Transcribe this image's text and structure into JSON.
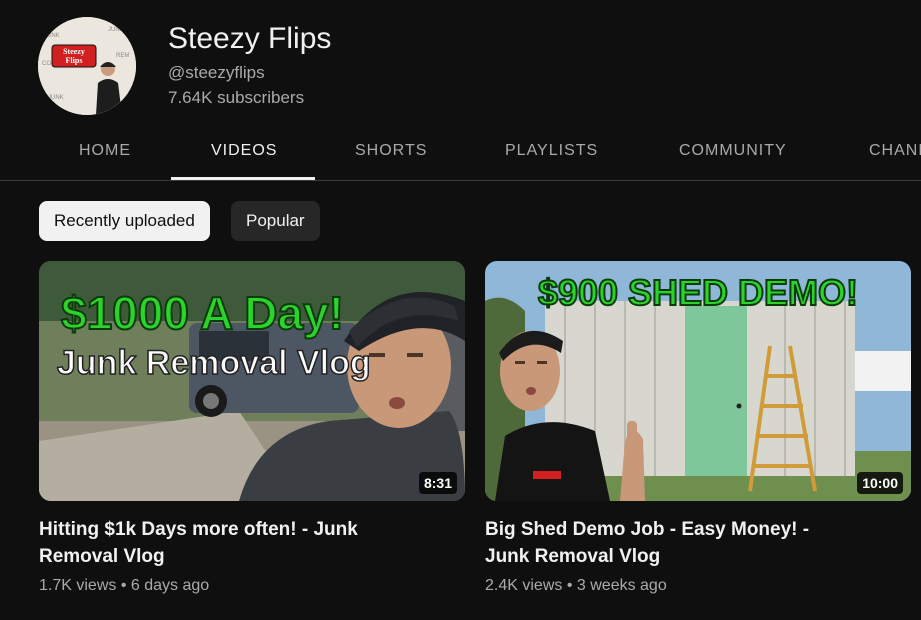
{
  "channel": {
    "name": "Steezy Flips",
    "handle": "@steezyflips",
    "subscribers": "7.64K subscribers",
    "avatar_text": "Steezy Flips"
  },
  "tabs": [
    {
      "label": "HOME",
      "active": false
    },
    {
      "label": "VIDEOS",
      "active": true
    },
    {
      "label": "SHORTS",
      "active": false
    },
    {
      "label": "PLAYLISTS",
      "active": false
    },
    {
      "label": "COMMUNITY",
      "active": false
    },
    {
      "label": "CHANNELS",
      "active": false
    }
  ],
  "chips": [
    {
      "label": "Recently uploaded",
      "selected": true
    },
    {
      "label": "Popular",
      "selected": false
    }
  ],
  "videos": [
    {
      "title": "Hitting $1k Days more often! - Junk Removal Vlog",
      "views": "1.7K views",
      "age": "6 days ago",
      "duration": "8:31",
      "thumb_text_1": "$1000 A Day!",
      "thumb_text_2": "Junk Removal Vlog"
    },
    {
      "title": "Big Shed Demo Job - Easy Money! - Junk Removal Vlog",
      "views": "2.4K views",
      "age": "3 weeks ago",
      "duration": "10:00",
      "thumb_text_1": "$900 SHED DEMO!"
    }
  ],
  "meta_separator": "•",
  "colors": {
    "background": "#0f0f0f",
    "thumb_green_text": "#2bd42b"
  }
}
